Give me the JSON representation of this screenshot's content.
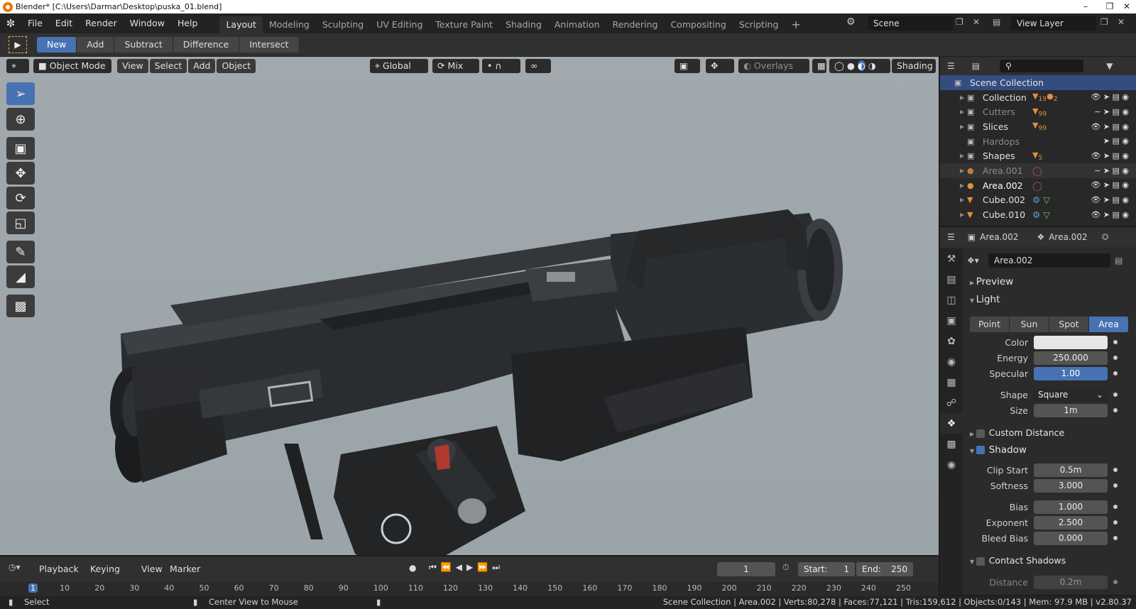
{
  "window": {
    "title": "Blender* [C:\\Users\\Darmar\\Desktop\\puska_01.blend]"
  },
  "menus": [
    "File",
    "Edit",
    "Render",
    "Window",
    "Help"
  ],
  "workspaces": [
    "Layout",
    "Modeling",
    "Sculpting",
    "UV Editing",
    "Texture Paint",
    "Shading",
    "Animation",
    "Rendering",
    "Compositing",
    "Scripting"
  ],
  "scene": {
    "name": "Scene",
    "view_layer": "View Layer"
  },
  "booltool": {
    "buttons": [
      "New",
      "Add",
      "Subtract",
      "Difference",
      "Intersect"
    ]
  },
  "viewport": {
    "mode": "Object Mode",
    "menus": [
      "View",
      "Select",
      "Add",
      "Object"
    ],
    "orientation": "Global",
    "pivot": "Mix",
    "overlays": "Overlays",
    "shading": "Shading"
  },
  "outliner": {
    "root": "Scene Collection",
    "rows": [
      {
        "name": "Collection",
        "badge": "19",
        "badge2": "2"
      },
      {
        "name": "Cutters",
        "badge": "99"
      },
      {
        "name": "Slices",
        "badge": "99"
      },
      {
        "name": "Hardops",
        "badge": ""
      },
      {
        "name": "Shapes",
        "badge": "5"
      },
      {
        "name": "Area.001",
        "badge": ""
      },
      {
        "name": "Area.002",
        "badge": ""
      },
      {
        "name": "Cube.002",
        "badge": ""
      },
      {
        "name": "Cube.010",
        "badge": ""
      }
    ]
  },
  "properties": {
    "object": "Area.002",
    "data": "Area.002",
    "datablock": "Area.002",
    "preview": "Preview",
    "light": "Light",
    "light_types": [
      "Point",
      "Sun",
      "Spot",
      "Area"
    ],
    "color_label": "Color",
    "energy_label": "Energy",
    "energy": "250.000",
    "specular_label": "Specular",
    "specular": "1.00",
    "shape_label": "Shape",
    "shape": "Square",
    "size_label": "Size",
    "size": "1m",
    "custom_distance": "Custom Distance",
    "shadow": "Shadow",
    "clip_start_label": "Clip Start",
    "clip_start": "0.5m",
    "softness_label": "Softness",
    "softness": "3.000",
    "bias_label": "Bias",
    "bias": "1.000",
    "exponent_label": "Exponent",
    "exponent": "2.500",
    "bleed_bias_label": "Bleed Bias",
    "bleed_bias": "0.000",
    "contact_shadows": "Contact Shadows",
    "distance_label": "Distance",
    "distance": "0.2m"
  },
  "timeline": {
    "menus": [
      "Playback",
      "Keying",
      "View",
      "Marker"
    ],
    "current_frame": "1",
    "start_label": "Start:",
    "start": "1",
    "end_label": "End:",
    "end": "250",
    "ticks": [
      "1",
      "10",
      "20",
      "30",
      "40",
      "50",
      "60",
      "70",
      "80",
      "90",
      "100",
      "110",
      "120",
      "130",
      "140",
      "150",
      "160",
      "170",
      "180",
      "190",
      "200",
      "210",
      "220",
      "230",
      "240",
      "250"
    ]
  },
  "status": {
    "left": "Select",
    "middle": "Center View to Mouse",
    "right": "Scene Collection | Area.002 | Verts:80,278 | Faces:77,121 | Tris:159,612 | Objects:0/143 | Mem: 97.9 MB | v2.80.37"
  },
  "colors": {
    "accent": "#4772b3",
    "bg": "#303030"
  }
}
